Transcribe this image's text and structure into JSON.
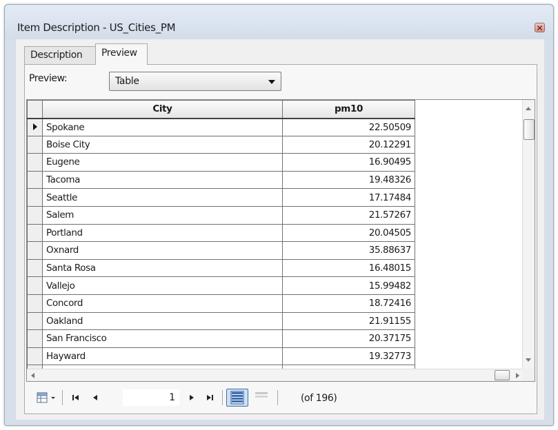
{
  "window": {
    "title": "Item Description - US_Cities_PM"
  },
  "tabs": [
    {
      "label": "Description",
      "active": false
    },
    {
      "label": "Preview",
      "active": true
    }
  ],
  "preview": {
    "label": "Preview:",
    "mode_selected": "Table"
  },
  "table": {
    "columns": [
      "City",
      "pm10"
    ],
    "rows": [
      {
        "city": "Spokane",
        "pm10": "22.50509"
      },
      {
        "city": "Boise City",
        "pm10": "20.12291"
      },
      {
        "city": "Eugene",
        "pm10": "16.90495"
      },
      {
        "city": "Tacoma",
        "pm10": "19.48326"
      },
      {
        "city": "Seattle",
        "pm10": "17.17484"
      },
      {
        "city": "Salem",
        "pm10": "21.57267"
      },
      {
        "city": "Portland",
        "pm10": "20.04505"
      },
      {
        "city": "Oxnard",
        "pm10": "35.88637"
      },
      {
        "city": "Santa Rosa",
        "pm10": "16.48015"
      },
      {
        "city": "Vallejo",
        "pm10": "15.99482"
      },
      {
        "city": "Concord",
        "pm10": "18.72416"
      },
      {
        "city": "Oakland",
        "pm10": "21.91155"
      },
      {
        "city": "San Francisco",
        "pm10": "20.37175"
      },
      {
        "city": "Hayward",
        "pm10": "19.32773"
      }
    ]
  },
  "navigation": {
    "current_record": "1",
    "record_count_text": "(of 196)"
  },
  "icons": {
    "options": "table-options-icon",
    "first": "first-record-icon",
    "prev": "previous-record-icon",
    "next": "next-record-icon",
    "last": "last-record-icon",
    "show_all": "show-all-records-icon",
    "show_selected": "show-selected-records-icon",
    "close": "close-icon"
  },
  "colors": {
    "title_bar": "#d6dfea",
    "close_button": "#d98f84",
    "selected_view": "#3a6fb0"
  }
}
